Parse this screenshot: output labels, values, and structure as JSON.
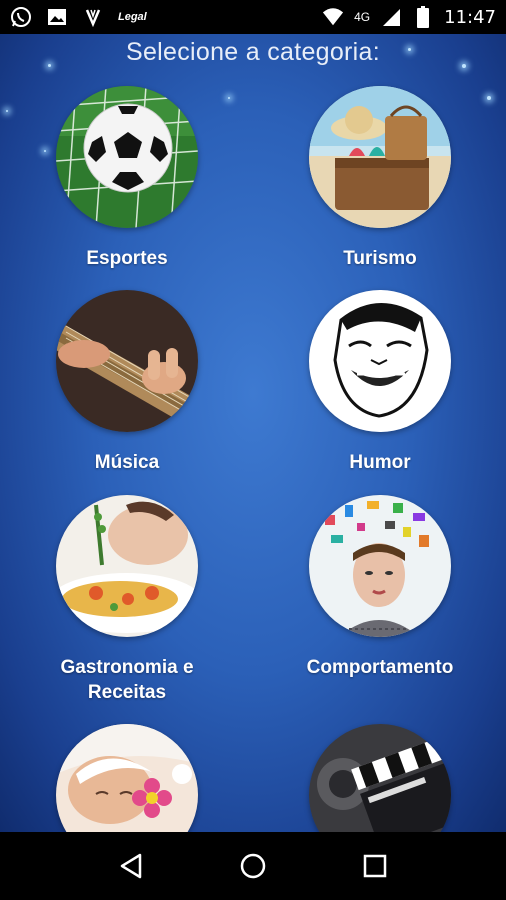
{
  "status_bar": {
    "app_icons": [
      "whatsapp-icon",
      "gallery-icon",
      "vivo-icon",
      "legal-icon"
    ],
    "legal_text": "Legal",
    "network": "4G",
    "time": "11:47"
  },
  "page": {
    "title": "Selecione a categoria:"
  },
  "categories": [
    {
      "label": "Esportes",
      "icon": "soccer-ball"
    },
    {
      "label": "Turismo",
      "icon": "beach-bag"
    },
    {
      "label": "Música",
      "icon": "guitar"
    },
    {
      "label": "Humor",
      "icon": "meme-face"
    },
    {
      "label": "Gastronomia e Receitas",
      "icon": "food-plate"
    },
    {
      "label": "Comportamento",
      "icon": "thinking-head"
    },
    {
      "label": "",
      "icon": "spa-flower"
    },
    {
      "label": "",
      "icon": "film-clapper"
    }
  ],
  "colors": {
    "background_center": "#3e7ad1",
    "background_edge": "#102c6e",
    "label": "#ffffff"
  },
  "nav_bar": {
    "buttons": [
      "back",
      "home",
      "recents"
    ]
  }
}
